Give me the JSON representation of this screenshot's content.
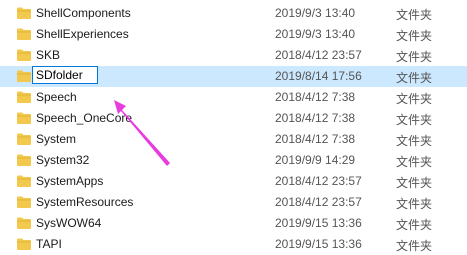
{
  "colors": {
    "selected_row": "#cce8ff",
    "folder_icon": "#f2c94c",
    "arrow": "#e83be0"
  },
  "files": [
    {
      "name": "ShellComponents",
      "date": "2019/9/3 13:40",
      "type": "文件夹"
    },
    {
      "name": "ShellExperiences",
      "date": "2019/9/3 13:40",
      "type": "文件夹"
    },
    {
      "name": "SKB",
      "date": "2018/4/12 23:57",
      "type": "文件夹"
    },
    {
      "name": "SDfolder",
      "date": "2019/8/14 17:56",
      "type": "文件夹",
      "renaming": true
    },
    {
      "name": "Speech",
      "date": "2018/4/12 7:38",
      "type": "文件夹"
    },
    {
      "name": "Speech_OneCore",
      "date": "2018/4/12 7:38",
      "type": "文件夹"
    },
    {
      "name": "System",
      "date": "2018/4/12 7:38",
      "type": "文件夹"
    },
    {
      "name": "System32",
      "date": "2019/9/9 14:29",
      "type": "文件夹"
    },
    {
      "name": "SystemApps",
      "date": "2018/4/12 23:57",
      "type": "文件夹"
    },
    {
      "name": "SystemResources",
      "date": "2018/4/12 23:57",
      "type": "文件夹"
    },
    {
      "name": "SysWOW64",
      "date": "2019/9/15 13:36",
      "type": "文件夹"
    },
    {
      "name": "TAPI",
      "date": "2019/9/15 13:36",
      "type": "文件夹"
    }
  ]
}
